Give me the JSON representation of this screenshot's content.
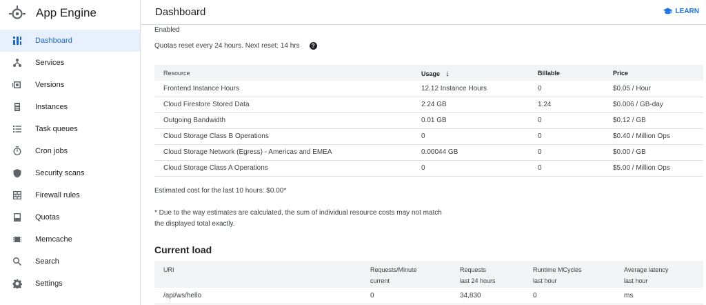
{
  "brand": {
    "title": "App Engine"
  },
  "sidebar": {
    "items": [
      {
        "label": "Dashboard",
        "icon": "dashboard-icon",
        "active": true
      },
      {
        "label": "Services",
        "icon": "services-icon"
      },
      {
        "label": "Versions",
        "icon": "versions-icon"
      },
      {
        "label": "Instances",
        "icon": "instances-icon"
      },
      {
        "label": "Task queues",
        "icon": "task-queues-icon"
      },
      {
        "label": "Cron jobs",
        "icon": "cron-jobs-icon"
      },
      {
        "label": "Security scans",
        "icon": "security-scans-icon"
      },
      {
        "label": "Firewall rules",
        "icon": "firewall-rules-icon"
      },
      {
        "label": "Quotas",
        "icon": "quotas-icon"
      },
      {
        "label": "Memcache",
        "icon": "memcache-icon"
      },
      {
        "label": "Search",
        "icon": "search-icon"
      },
      {
        "label": "Settings",
        "icon": "settings-icon"
      }
    ]
  },
  "header": {
    "title": "Dashboard",
    "learn_label": "LEARN"
  },
  "status": {
    "enabled": "Enabled",
    "quota_reset": "Quotas reset every 24 hours. Next reset: 14 hrs",
    "help_glyph": "?"
  },
  "resources": {
    "headers": {
      "resource": "Resource",
      "usage": "Usage",
      "usage_sort": "↓",
      "billable": "Billable",
      "price": "Price"
    },
    "rows": [
      {
        "resource": "Frontend Instance Hours",
        "usage": "12.12 Instance Hours",
        "billable": "0",
        "price": "$0.05 / Hour"
      },
      {
        "resource": "Cloud Firestore Stored Data",
        "usage": "2.24 GB",
        "billable": "1.24",
        "price": "$0.006 / GB-day"
      },
      {
        "resource": "Outgoing Bandwidth",
        "usage": "0.01 GB",
        "billable": "0",
        "price": "$0.12 / GB"
      },
      {
        "resource": "Cloud Storage Class B Operations",
        "usage": "0",
        "billable": "0",
        "price": "$0.40 / Million Ops"
      },
      {
        "resource": "Cloud Storage Network (Egress) - Americas and EMEA",
        "usage": "0.00044 GB",
        "billable": "0",
        "price": "$0.00 / GB"
      },
      {
        "resource": "Cloud Storage Class A Operations",
        "usage": "0",
        "billable": "0",
        "price": "$5.00 / Million Ops"
      }
    ]
  },
  "estimate": "Estimated cost for the last 10 hours: $0.00*",
  "footnote": "* Due to the way estimates are calculated, the sum of individual resource costs may not match the displayed total exactly.",
  "current_load": {
    "title": "Current load",
    "headers": [
      {
        "line1": "URI",
        "line2": ""
      },
      {
        "line1": "Requests/Minute",
        "line2": "current"
      },
      {
        "line1": "Requests",
        "line2": "last 24 hours"
      },
      {
        "line1": "Runtime MCycles",
        "line2": "last hour"
      },
      {
        "line1": "Average latency",
        "line2": "last hour"
      }
    ],
    "rows": [
      {
        "uri": "/api/ws/hello",
        "rpm": "0",
        "requests": "34,830",
        "mcycles": "0",
        "latency": "ms"
      }
    ]
  },
  "colors": {
    "accent": "#1a73e8",
    "active_bg": "#e8f0fe",
    "header_bg": "#f1f3f4"
  }
}
